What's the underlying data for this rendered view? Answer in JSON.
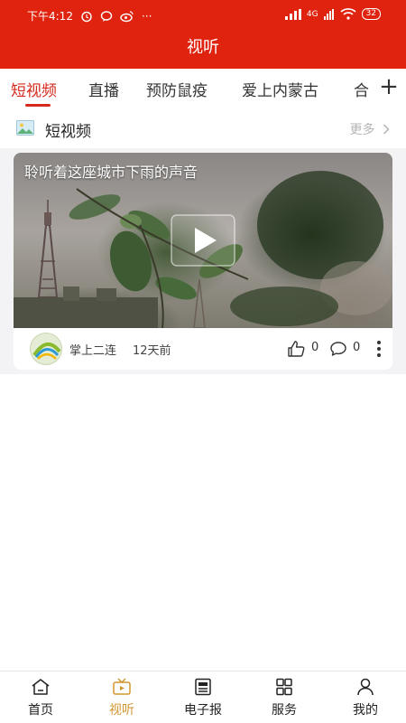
{
  "status_bar": {
    "time": "下午4:12",
    "notification_icons": [
      "alarm-icon",
      "chat-icon",
      "weibo-icon"
    ],
    "more_icon": "···",
    "network": "4G",
    "battery": "32"
  },
  "header": {
    "title": "视听"
  },
  "tabs": [
    {
      "label": "短视频",
      "active": true
    },
    {
      "label": "直播",
      "active": false
    },
    {
      "label": "预防鼠疫",
      "active": false
    },
    {
      "label": "爱上内蒙古",
      "active": false
    },
    {
      "label": "合",
      "active": false
    }
  ],
  "add_tab_symbol": "+",
  "section": {
    "title": "短视频",
    "more_label": "更多"
  },
  "video_card": {
    "title": "聆听着这座城市下雨的声音",
    "author": "掌上二连",
    "time": "12天前",
    "likes": "0",
    "comments": "0"
  },
  "bottom_nav": [
    {
      "label": "首页",
      "icon": "home-icon",
      "active": false
    },
    {
      "label": "视听",
      "icon": "tv-icon",
      "active": true
    },
    {
      "label": "电子报",
      "icon": "newspaper-icon",
      "active": false
    },
    {
      "label": "服务",
      "icon": "grid-icon",
      "active": false
    },
    {
      "label": "我的",
      "icon": "user-icon",
      "active": false
    }
  ],
  "colors": {
    "primary_red": "#e0230f",
    "active_tab": "#d42a1c",
    "active_nav": "#d2962f"
  }
}
